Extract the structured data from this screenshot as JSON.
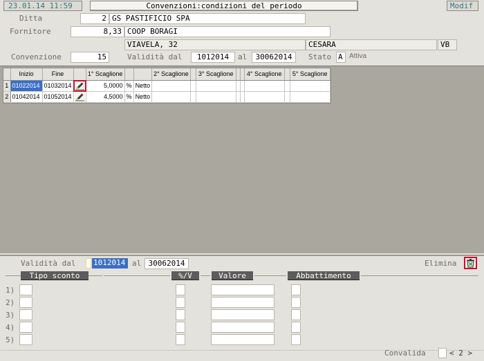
{
  "header": {
    "datetime": "23.01.14 11:59",
    "title": "Convenzioni:condizioni del periodo",
    "mode": "Modif"
  },
  "form": {
    "ditta_label": "Ditta",
    "ditta_code": "2",
    "ditta_name": "GS PASTIFICIO SPA",
    "fornitore_label": "Fornitore",
    "fornitore_code": "8,33",
    "fornitore_name": "COOP BORAGI",
    "address": "VIAVELA, 32",
    "city": "CESARA",
    "province": "VB",
    "convenzione_label": "Convenzione",
    "convenzione_value": "15",
    "validita_label": "Validità dal",
    "validita_from": "1012014",
    "al_label": "al",
    "validita_to": "30062014",
    "stato_label": "Stato",
    "stato_value": "A",
    "stato_desc": "Attiva"
  },
  "grid": {
    "columns": [
      "Inizio",
      "Fine",
      "",
      "1° Scaglione",
      "",
      "",
      "2° Scaglione",
      "",
      "3° Scaglione",
      "",
      "",
      "4° Scaglione",
      "",
      "5° Scaglione"
    ],
    "rows": [
      {
        "n": "1",
        "inizio": "01022014",
        "fine": "01032014",
        "s1": "5,0000",
        "pct": "%",
        "tipo": "Netto"
      },
      {
        "n": "2",
        "inizio": "01042014",
        "fine": "01052014",
        "s1": "4,5000",
        "pct": "%",
        "tipo": "Netto"
      }
    ]
  },
  "bottom": {
    "validita_label": "Validità dal",
    "validita_from": "1012014",
    "al_label": "al",
    "validita_to": "30062014",
    "elimina_label": "Elimina",
    "col_tipo": "Tipo sconto",
    "col_pv": "%/V",
    "col_valore": "Valore",
    "col_abbattimento": "Abbattimento",
    "row_labels": [
      "1)",
      "2)",
      "3)",
      "4)",
      "5)"
    ],
    "convalida_label": "Convalida",
    "page_nav": "< 2 >"
  },
  "icons": {
    "edit": "edit-pencil-icon",
    "delete": "trash-bin-icon"
  },
  "colors": {
    "accent_red": "#c8102e",
    "selection_blue": "#3b6fc4",
    "header_teal": "#2e7a80"
  }
}
